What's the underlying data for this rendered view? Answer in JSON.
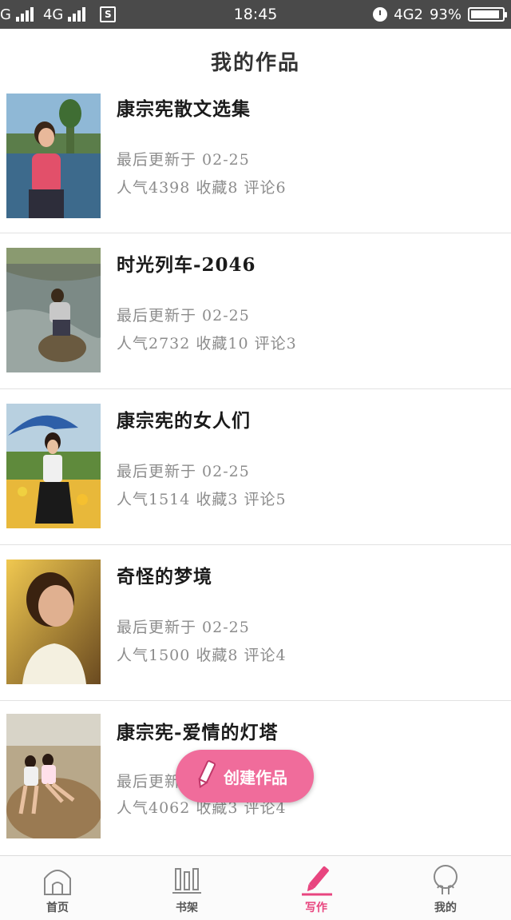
{
  "status_bar": {
    "carrier1": "G",
    "carrier2": "4G",
    "time": "18:45",
    "network": "4G2",
    "battery": "93%",
    "battery_level": 0.93
  },
  "header": {
    "title": "我的作品"
  },
  "works": [
    {
      "title": "康宗宪散文选集",
      "updated": "最后更新于 02-25",
      "stats": "人气4398 收藏8 评论6"
    },
    {
      "title": "时光列车-2046",
      "updated": "最后更新于 02-25",
      "stats": "人气2732 收藏10 评论3"
    },
    {
      "title": "康宗宪的女人们",
      "updated": "最后更新于 02-25",
      "stats": "人气1514 收藏3 评论5"
    },
    {
      "title": "奇怪的梦境",
      "updated": "最后更新于 02-25",
      "stats": "人气1500 收藏8 评论4"
    },
    {
      "title": "康宗宪-爱情的灯塔",
      "updated": "最后更新于 02-25",
      "stats": "人气4062 收藏3 评论4"
    }
  ],
  "fab": {
    "label": "创建作品",
    "icon": "pencil-icon"
  },
  "bottom_nav": [
    {
      "label": "首页",
      "icon": "home-icon",
      "active": false
    },
    {
      "label": "书架",
      "icon": "bookshelf-icon",
      "active": false
    },
    {
      "label": "写作",
      "icon": "write-icon",
      "active": true
    },
    {
      "label": "我的",
      "icon": "profile-icon",
      "active": false
    }
  ],
  "colors": {
    "accent": "#f06c9b",
    "active_nav": "#e8457f",
    "status_bar": "#4a4a4a"
  }
}
